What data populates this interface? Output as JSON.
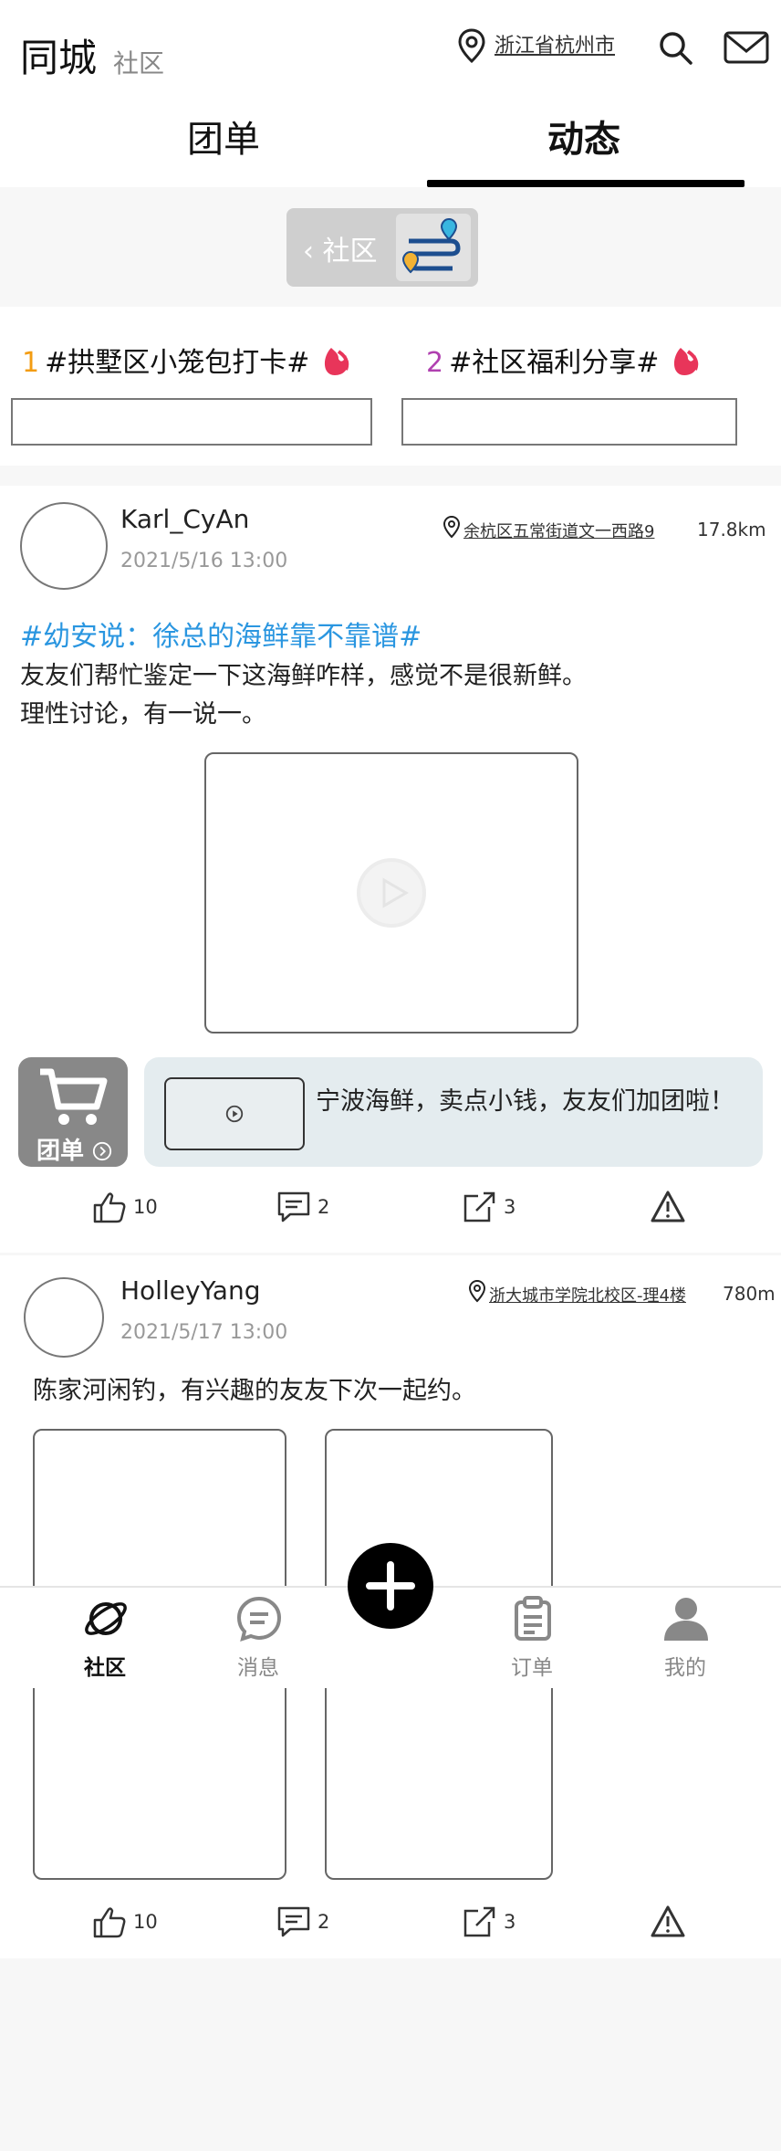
{
  "header": {
    "app_title": "同城",
    "app_subtitle": "社区",
    "location": "浙江省杭州市",
    "icons": {
      "location": "location-pin-icon",
      "search": "search-icon",
      "mail": "mail-icon"
    }
  },
  "tabs": [
    {
      "label": "团单",
      "active": false
    },
    {
      "label": "动态",
      "active": true
    }
  ],
  "community_chip": {
    "label": "‹ 社区",
    "icon": "map-route-icon"
  },
  "topics": [
    {
      "rank": "1",
      "title": "#拱墅区小笼包打卡#",
      "rank_color": "#f39c12",
      "icon": "flame-icon"
    },
    {
      "rank": "2",
      "title": "#社区福利分享#",
      "rank_color": "#b040b0",
      "icon": "flame-icon"
    }
  ],
  "posts": [
    {
      "username": "Karl_CyAn",
      "timestamp": "2021/5/16   13:00",
      "location": "余杭区五常街道文一西路9",
      "distance": "17.8km",
      "hashtag": "#幼安说：徐总的海鲜靠不靠谱#",
      "body": "友友们帮忙鉴定一下这海鲜咋样，感觉不是很新鲜。\n理性讨论，有一说一。",
      "media": "video",
      "group_buy": {
        "label": "团单",
        "text": "宁波海鲜，卖点小钱，友友们加团啦！"
      },
      "likes": "10",
      "comments": "2",
      "shares": "3"
    },
    {
      "username": "HolleyYang",
      "timestamp": "2021/5/17   13:00",
      "location": "浙大城市学院北校区-理4楼",
      "distance": "780m",
      "body": "陈家河闲钓，有兴趣的友友下次一起约。",
      "media": "images",
      "likes": "10",
      "comments": "2",
      "shares": "3"
    }
  ],
  "bottom_nav": [
    {
      "label": "社区",
      "icon": "planet-icon",
      "active": true
    },
    {
      "label": "消息",
      "icon": "message-icon",
      "active": false
    },
    {
      "label": "订单",
      "icon": "clipboard-icon",
      "active": false
    },
    {
      "label": "我的",
      "icon": "user-icon",
      "active": false
    }
  ],
  "fab": {
    "icon": "plus-icon"
  },
  "colors": {
    "accent": "#2a96e0",
    "active_tab_underline": "#000000",
    "group_buy_card": "#e4ecef"
  }
}
